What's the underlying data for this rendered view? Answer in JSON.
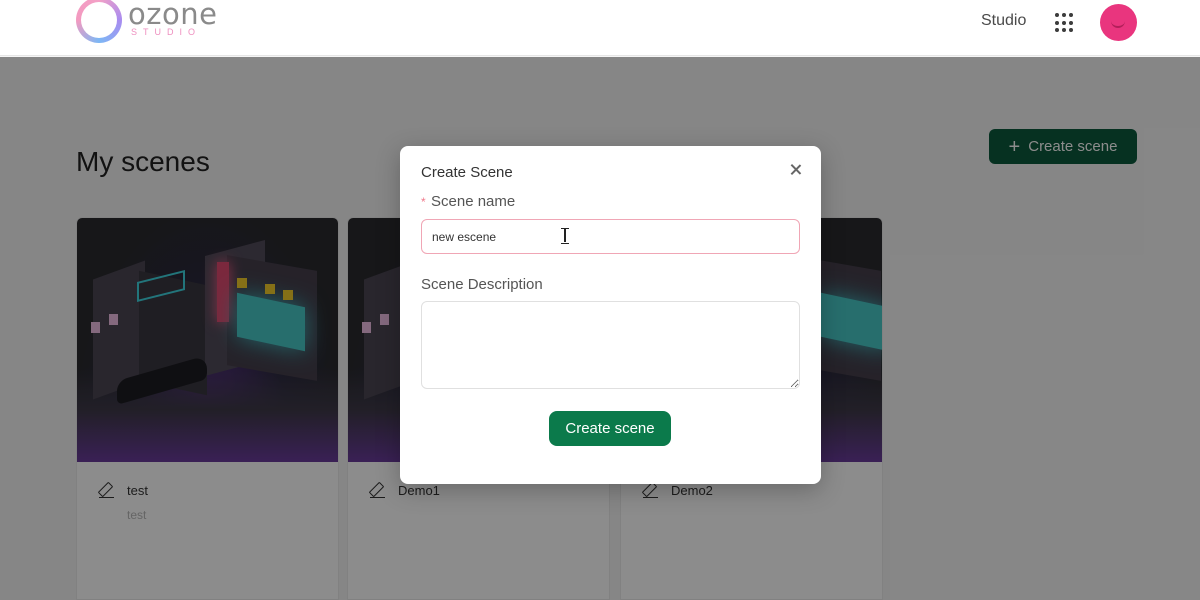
{
  "header": {
    "logo_word": "ozone",
    "logo_sub": "STUDIO",
    "nav_studio": "Studio"
  },
  "page": {
    "title": "My scenes",
    "create_button": "Create scene",
    "create_icon": "+"
  },
  "scenes": [
    {
      "name": "test",
      "description": "test"
    },
    {
      "name": "Demo1",
      "description": ""
    },
    {
      "name": "Demo2",
      "description": ""
    }
  ],
  "modal": {
    "title": "Create Scene",
    "required_mark": "*",
    "name_label": "Scene name",
    "name_value": "new escene",
    "description_label": "Scene Description",
    "description_value": "",
    "submit_label": "Create scene"
  },
  "colors": {
    "primary_green": "#0b5a3c",
    "modal_button_green": "#0b7a4b",
    "avatar_pink": "#e9357e",
    "input_focus_border": "#f0a6b5",
    "required_star": "#f07a8c"
  },
  "icons": [
    "logo-ring-icon",
    "apps-grid-icon",
    "avatar",
    "plus-icon",
    "edit-icon",
    "close-icon",
    "text-cursor-icon"
  ]
}
